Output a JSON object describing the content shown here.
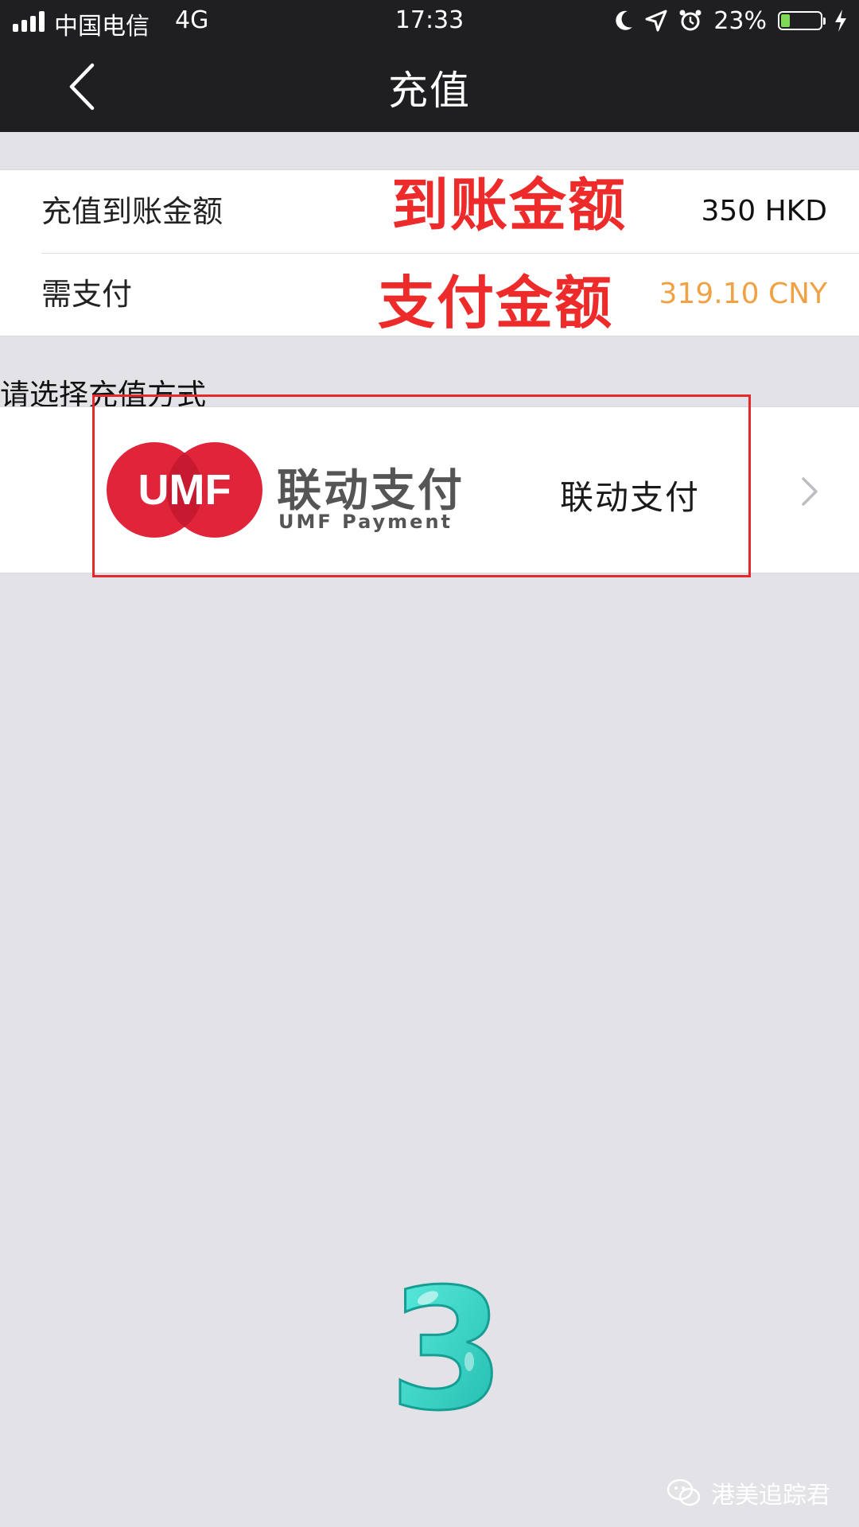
{
  "status_bar": {
    "carrier": "中国电信",
    "network": "4G",
    "time": "17:33",
    "battery_percent": "23%",
    "battery_level": 0.23,
    "icons": [
      "signal-icon",
      "moon-icon",
      "location-icon",
      "alarm-icon",
      "battery-icon",
      "charging-icon"
    ]
  },
  "nav": {
    "title": "充值",
    "back_icon": "chevron-left-icon"
  },
  "amounts": {
    "credited_label": "充值到账金额",
    "credited_value": "350 HKD",
    "pay_label": "需支付",
    "pay_value": "319.10 CNY"
  },
  "annotations": {
    "credited_note": "到账金额",
    "pay_note": "支付金额",
    "highlight_color": "#e4282c"
  },
  "payment": {
    "section_title": "请选择充值方式",
    "logo_text": "UMF",
    "logo_cn": "联动支付",
    "logo_en": "UMF Payment",
    "method_name": "联动支付",
    "chevron_icon": "chevron-right-icon"
  },
  "decoration": {
    "step_number": "3"
  },
  "watermark": {
    "text": "港美追踪君",
    "icon": "wechat-icon"
  },
  "colors": {
    "nav_bg": "#1f1f22",
    "page_bg": "#e3e2e7",
    "pay_value": "#f0a144",
    "annotation": "#ee2b2b",
    "umf_red": "#e0243a"
  }
}
